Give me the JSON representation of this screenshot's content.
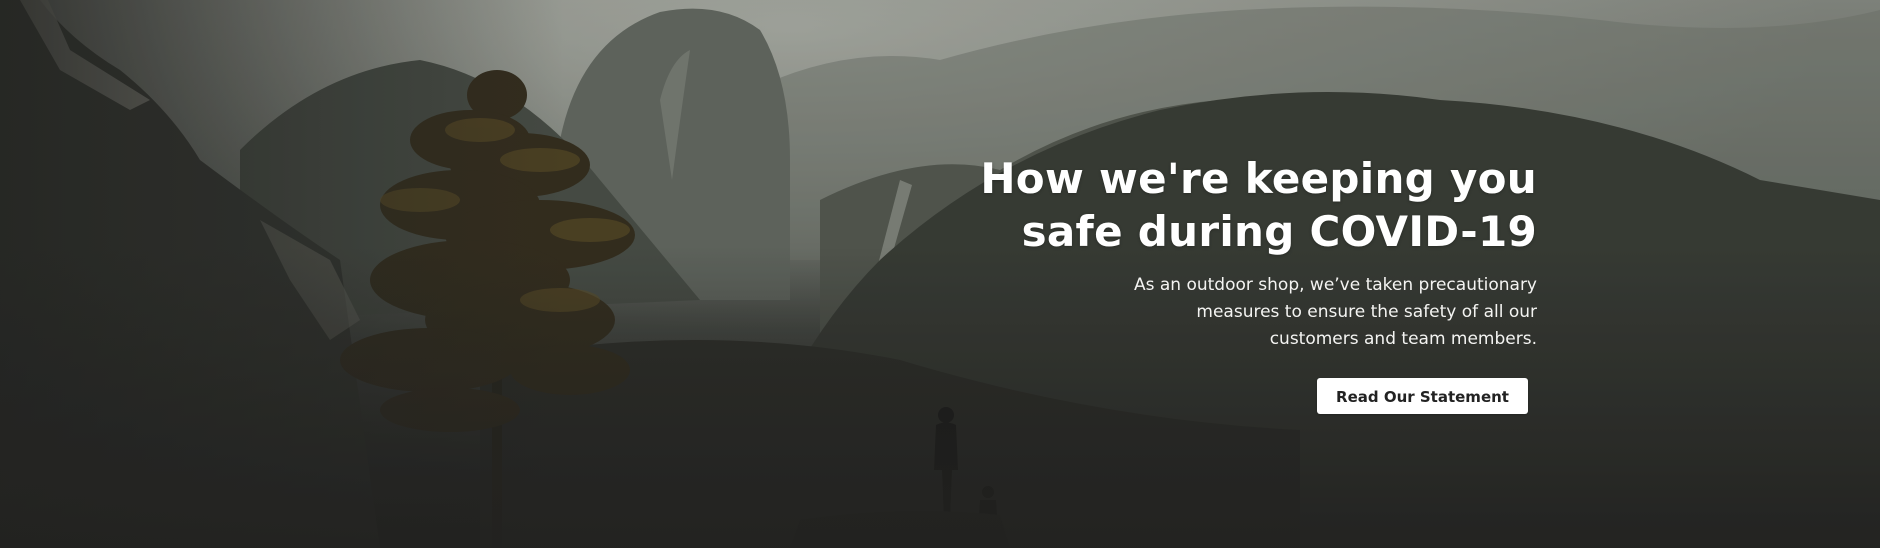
{
  "hero": {
    "title_line1": "How we're keeping you",
    "title_line2": "safe during COVID-19",
    "text_line1": "As an outdoor shop, we’ve taken precautionary",
    "text_line2": "measures to ensure the safety of all our",
    "text_line3": "customers and team members.",
    "button_label": "Read Our Statement"
  },
  "colors": {
    "text": "#ffffff",
    "button_bg": "#ffffff",
    "button_text": "#222222",
    "sky_haze": "#9a9d95",
    "forest_dark": "#2b2b29"
  }
}
